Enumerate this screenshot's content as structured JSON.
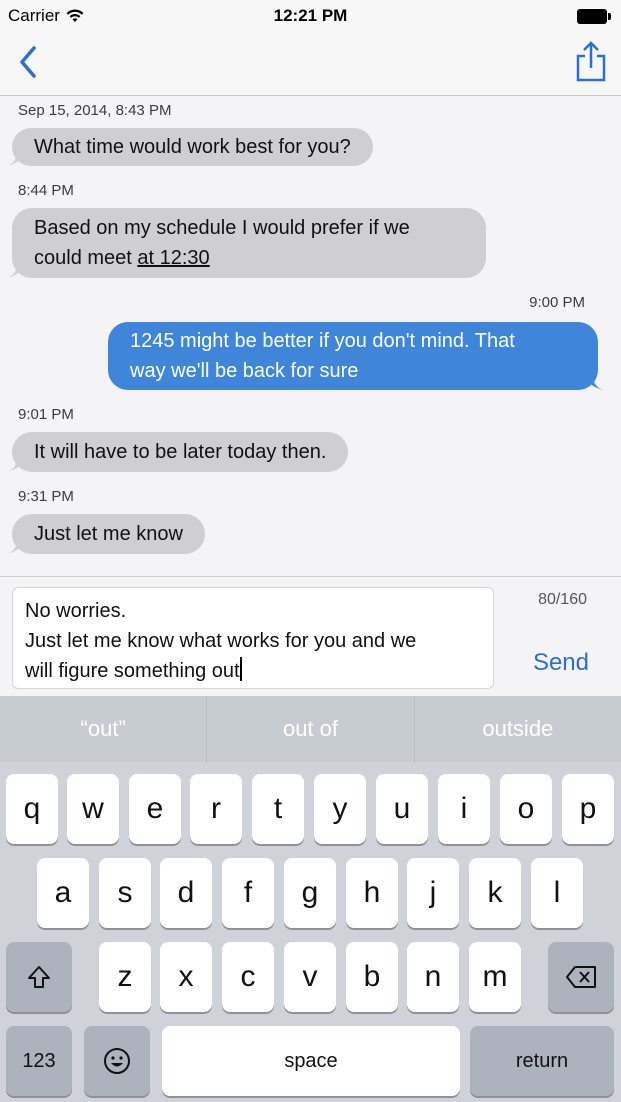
{
  "status": {
    "carrier": "Carrier",
    "time": "12:21 PM"
  },
  "nav": {
    "back_icon": "chevron-left-icon",
    "share_icon": "share-icon"
  },
  "colors": {
    "accent": "#2a6ed6",
    "outgoing": "#3f86db",
    "incoming": "#cfcfd2"
  },
  "messages": [
    {
      "timestamp": "Sep 15, 2014, 8:43 PM",
      "direction": "incoming",
      "text": "What time would work best for you?"
    },
    {
      "timestamp": "8:44 PM",
      "direction": "incoming",
      "line1": "Based on my schedule I would prefer if we",
      "line2_pre": "could meet ",
      "line2_link": "at 12:30"
    },
    {
      "timestamp": "9:00 PM",
      "direction": "outgoing",
      "line1": "1245 might be better if you don't mind. That",
      "line2": "way we'll be back for sure"
    },
    {
      "timestamp": "9:01 PM",
      "direction": "incoming",
      "text": "It will have to be later today then."
    },
    {
      "timestamp": "9:31 PM",
      "direction": "incoming",
      "text": "Just let me know"
    }
  ],
  "compose": {
    "line1": "No worries.",
    "line2": "Just let me know what works for you and we",
    "line3": "will figure something out",
    "char_count": "80/160",
    "send_label": "Send"
  },
  "keyboard": {
    "suggestions": [
      "“out”",
      "out of",
      "outside"
    ],
    "row1": [
      "q",
      "w",
      "e",
      "r",
      "t",
      "y",
      "u",
      "i",
      "o",
      "p"
    ],
    "row2": [
      "a",
      "s",
      "d",
      "f",
      "g",
      "h",
      "j",
      "k",
      "l"
    ],
    "row3": [
      "z",
      "x",
      "c",
      "v",
      "b",
      "n",
      "m"
    ],
    "numbers_label": "123",
    "space_label": "space",
    "return_label": "return",
    "shift_icon": "shift-icon",
    "delete_icon": "backspace-icon",
    "emoji_icon": "emoji-icon"
  }
}
